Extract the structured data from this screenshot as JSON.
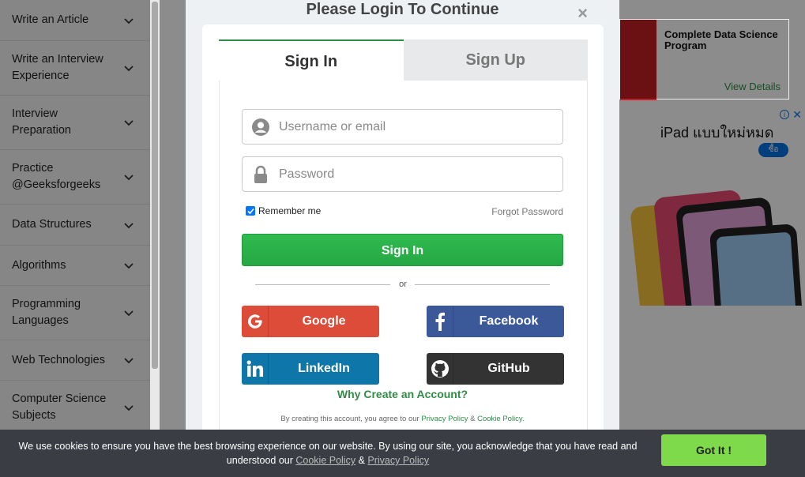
{
  "sidebar": {
    "items": [
      {
        "label": "Write an Article"
      },
      {
        "label": "Write an Interview Experience"
      },
      {
        "label": "Interview Preparation"
      },
      {
        "label": "Practice @Geeksforgeeks"
      },
      {
        "label": "Data Structures"
      },
      {
        "label": "Algorithms"
      },
      {
        "label": "Programming Languages"
      },
      {
        "label": "Web Technologies"
      },
      {
        "label": "Computer Science Subjects"
      }
    ]
  },
  "ads": {
    "ad1_title": "Complete Data Science Program",
    "ad1_cta": "View Details",
    "ad2_headline": "iPad แบบใหม่หมด",
    "ad2_button": "ซื้อ",
    "ad2_info": "i",
    "ad2_close": "✕"
  },
  "modal": {
    "title": "Please Login To Continue",
    "close": "×",
    "tabs": [
      {
        "label": "Sign In",
        "active": true
      },
      {
        "label": "Sign Up",
        "active": false
      }
    ],
    "username_placeholder": "Username or email",
    "password_placeholder": "Password",
    "remember_label": "Remember me",
    "remember_checked": true,
    "forgot_label": "Forgot Password",
    "signin_label": "Sign In",
    "or_label": "or",
    "social": {
      "google": "Google",
      "facebook": "Facebook",
      "linkedin": "LinkedIn",
      "github": "GitHub"
    },
    "why_label": "Why Create an Account?",
    "terms_prefix": "By creating this account, you agree to our ",
    "terms_privacy": "Privacy Policy",
    "terms_and": " & ",
    "terms_cookie": "Cookie Policy."
  },
  "cookie_bar": {
    "text_1": "We use cookies to ensure you have the best browsing experience on our website. By using our site, you acknowledge that you have read and understood our ",
    "cookie_link": "Cookie Policy",
    "and": " & ",
    "privacy_link": "Privacy Policy",
    "button": "Got It !"
  },
  "colors": {
    "brand_green": "#2f8d46",
    "signin_green": "#2fbb4f",
    "google": "#dd4b39",
    "facebook": "#3b5998",
    "linkedin": "#0e76a8",
    "github": "#333333",
    "got_it": "#7fda4b"
  }
}
